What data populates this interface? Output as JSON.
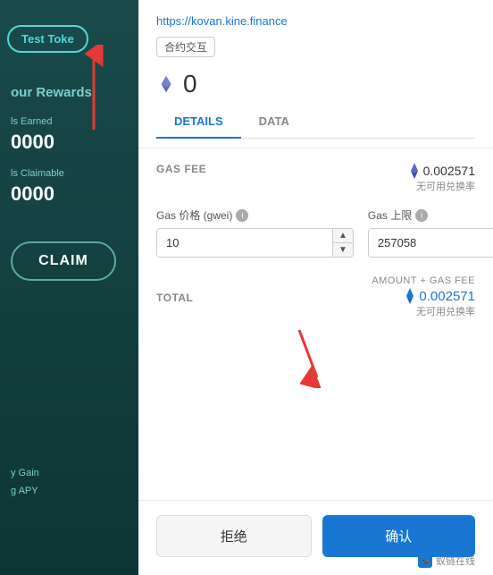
{
  "left_panel": {
    "test_token_btn": "Test Toke",
    "rewards_title": "our Rewards",
    "earned_label": "ls Earned",
    "earned_value": "0000",
    "claimable_label": "ls Claimable",
    "claimable_value": "0000",
    "claim_btn": "CLAIM",
    "gain_label": "y Gain",
    "apy_label": "g APY"
  },
  "modal": {
    "url": "https://kovan.kine.finance",
    "contract_tag": "合约交互",
    "eth_amount": "0",
    "tabs": [
      {
        "label": "DETAILS",
        "active": true
      },
      {
        "label": "DATA",
        "active": false
      }
    ],
    "gas_fee": {
      "label": "GAS FEE",
      "eth_prefix": "◆",
      "value": "0.002571",
      "no_exchange": "无可用兑换率"
    },
    "gas_price": {
      "label": "Gas 价格 (gwei)",
      "value": "10"
    },
    "gas_limit": {
      "label": "Gas 上限",
      "value": "257058"
    },
    "total": {
      "amount_gas_label": "AMOUNT + GAS FEE",
      "label": "TOTAL",
      "eth_prefix": "◆",
      "value": "0.002571",
      "no_exchange": "无可用兑换率"
    },
    "footer": {
      "reject_label": "拒绝",
      "confirm_label": "确认"
    },
    "watermark": "蚁链在线"
  }
}
